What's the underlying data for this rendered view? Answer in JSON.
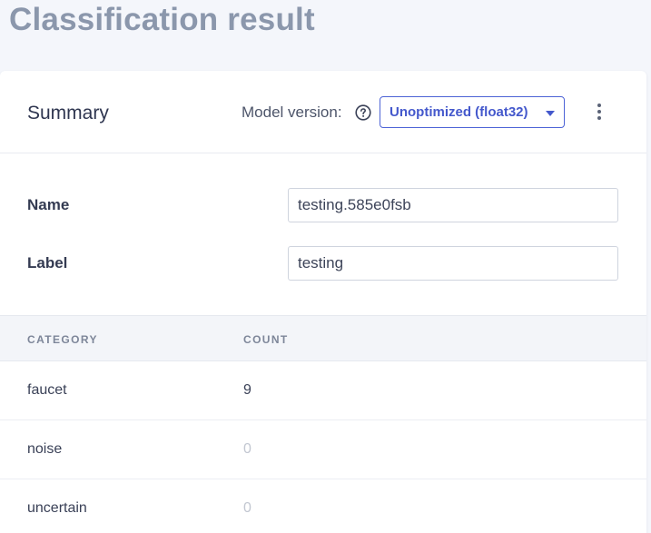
{
  "page": {
    "title": "Classification result"
  },
  "summary": {
    "title": "Summary",
    "model_version_label": "Model version:",
    "model_version_value": "Unoptimized (float32)",
    "icons": {
      "help": "help-circle-icon",
      "caret": "caret-down-icon",
      "menu": "more-vertical-icon"
    }
  },
  "form": {
    "name_label": "Name",
    "name_value": "testing.585e0fsb",
    "label_label": "Label",
    "label_value": "testing"
  },
  "table": {
    "headers": [
      "CATEGORY",
      "COUNT"
    ],
    "rows": [
      {
        "category": "faucet",
        "count": "9"
      },
      {
        "category": "noise",
        "count": "0"
      },
      {
        "category": "uncertain",
        "count": "0"
      }
    ]
  },
  "colors": {
    "accent": "#4458cc",
    "title": "#8b97ac",
    "zero_count": "#c2c7d1"
  }
}
